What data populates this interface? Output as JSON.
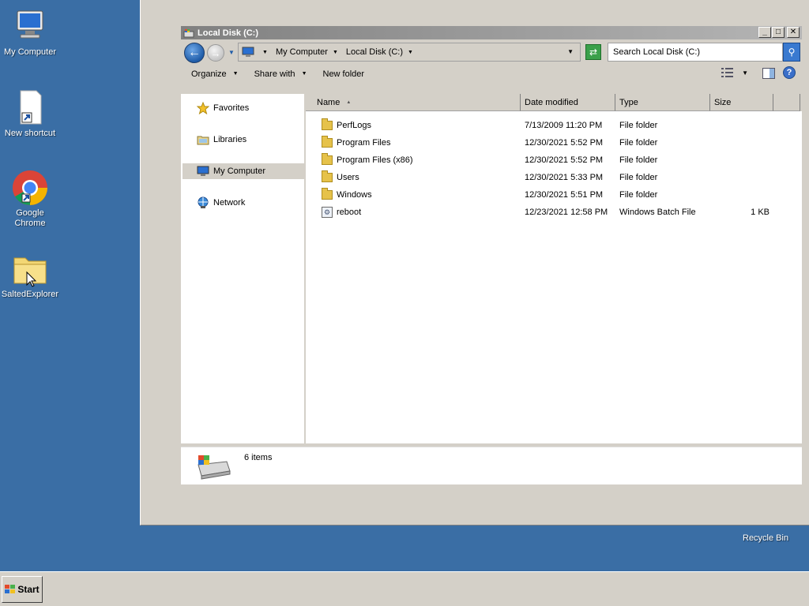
{
  "desktop": {
    "icons": [
      {
        "label": "My Computer",
        "icon": "computer-icon"
      },
      {
        "label": "New shortcut",
        "icon": "shortcut-file-icon"
      },
      {
        "label": "Google Chrome",
        "icon": "chrome-icon"
      },
      {
        "label": "SaltedExplorer",
        "icon": "folder-icon"
      }
    ],
    "recycle_bin": "Recycle Bin"
  },
  "window": {
    "title": "Local Disk (C:)",
    "controls": {
      "minimize": "_",
      "maximize": "□",
      "close": "✕"
    },
    "address": {
      "crumbs": [
        "My Computer",
        "Local Disk (C:)"
      ]
    },
    "search": {
      "placeholder": "Search Local Disk (C:)"
    },
    "commands": {
      "organize": "Organize",
      "share_with": "Share with",
      "new_folder": "New folder"
    },
    "nav": {
      "favorites": "Favorites",
      "libraries": "Libraries",
      "my_computer": "My Computer",
      "network": "Network"
    },
    "columns": {
      "name": "Name",
      "date": "Date modified",
      "type": "Type",
      "size": "Size"
    },
    "files": [
      {
        "name": "PerfLogs",
        "date": "7/13/2009 11:20 PM",
        "type": "File folder",
        "size": ""
      },
      {
        "name": "Program Files",
        "date": "12/30/2021 5:52 PM",
        "type": "File folder",
        "size": ""
      },
      {
        "name": "Program Files (x86)",
        "date": "12/30/2021 5:52 PM",
        "type": "File folder",
        "size": ""
      },
      {
        "name": "Users",
        "date": "12/30/2021 5:33 PM",
        "type": "File folder",
        "size": ""
      },
      {
        "name": "Windows",
        "date": "12/30/2021 5:51 PM",
        "type": "File folder",
        "size": ""
      },
      {
        "name": "reboot",
        "date": "12/23/2021 12:58 PM",
        "type": "Windows Batch File",
        "size": "1 KB"
      }
    ],
    "status": {
      "count": "6 items"
    }
  },
  "taskbar": {
    "start_label": "Start"
  }
}
